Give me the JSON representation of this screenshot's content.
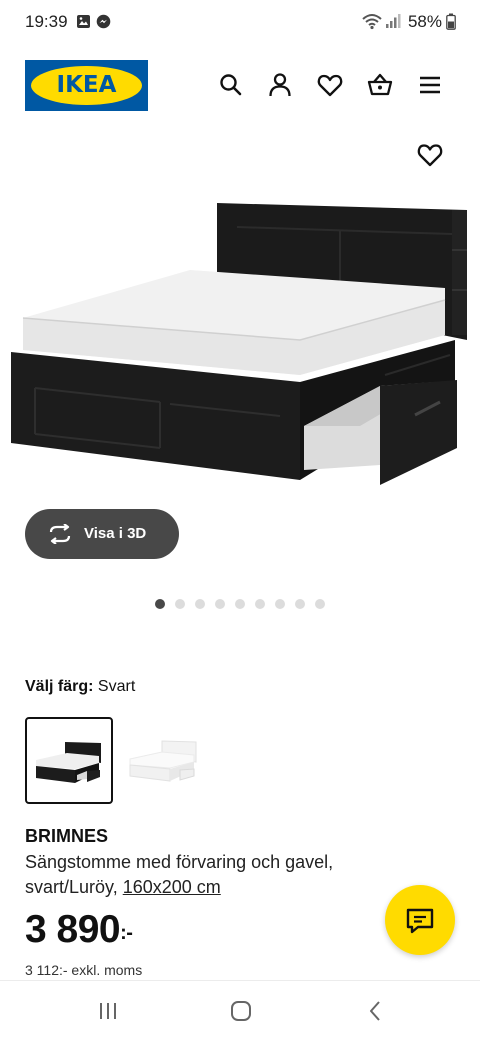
{
  "status_bar": {
    "time": "19:39",
    "battery": "58%",
    "icons": [
      "gallery-icon",
      "messenger-icon",
      "wifi-icon",
      "signal-icon",
      "battery-icon"
    ]
  },
  "header": {
    "logo_text": "IKEA",
    "icons": [
      "search-icon",
      "account-icon",
      "heart-icon",
      "basket-icon",
      "menu-icon"
    ],
    "brand_blue": "#0058a3",
    "brand_yellow": "#ffdb00"
  },
  "gallery": {
    "view_3d_label": "Visa i 3D",
    "image_count": 9,
    "active_index": 0
  },
  "color": {
    "label": "Välj färg:",
    "value": "Svart",
    "options": [
      "black",
      "white"
    ]
  },
  "product": {
    "name": "BRIMNES",
    "description": "Sängstomme med förvaring och gavel, svart/Luröy,",
    "size_link": "160x200 cm",
    "price": "3 890",
    "price_suffix": ":-",
    "price_excl": "3 112:- exkl. moms"
  },
  "chat": {
    "icon": "chat-icon"
  },
  "nav_bar": {
    "icons": [
      "recents-icon",
      "home-icon",
      "back-icon"
    ]
  }
}
